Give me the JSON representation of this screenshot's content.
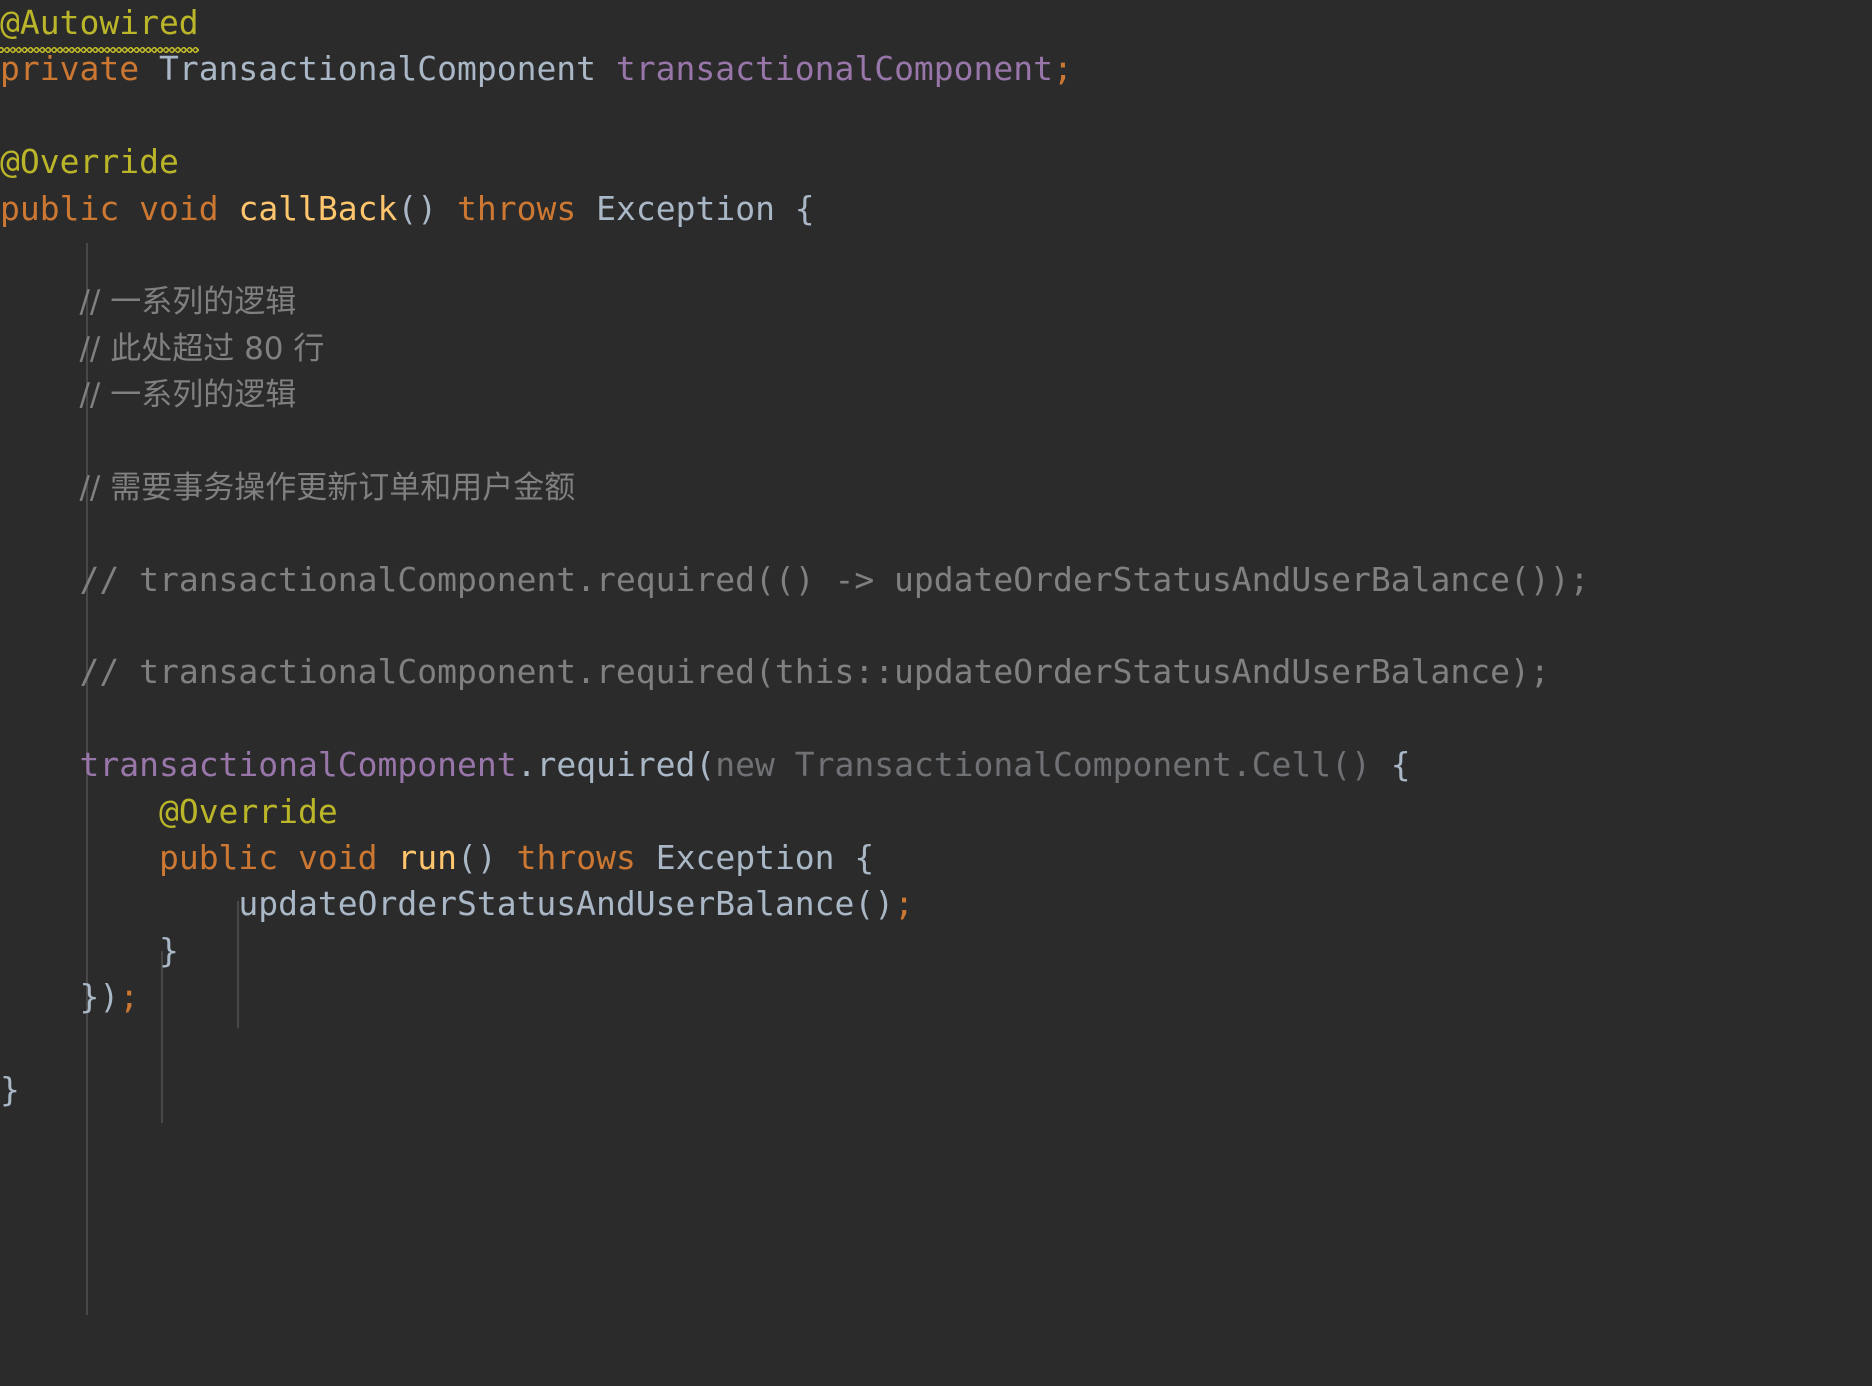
{
  "editor": {
    "background_color": "#2b2b2b",
    "language": "Java",
    "theme": "Darcula",
    "colors": {
      "default_text": "#a9b7c6",
      "annotation": "#bbb529",
      "keyword": "#cc7832",
      "method_name": "#ffc66d",
      "instance_field": "#9876aa",
      "comment": "#808080",
      "dimmed_inferred": "#6f7174",
      "indent_guide": "#4a4a4a",
      "warning_squiggle": "#bbb529"
    },
    "warnings": [
      {
        "target": "@Autowired",
        "style": "wavy-underline",
        "color": "#bbb529"
      }
    ],
    "lines": [
      {
        "n": 1,
        "indent": 0,
        "tokens": [
          {
            "t": "@Autowired",
            "c": "anno",
            "squiggle": true
          }
        ]
      },
      {
        "n": 2,
        "indent": 0,
        "tokens": [
          {
            "t": "private",
            "c": "kw"
          },
          {
            "t": " ",
            "c": "plain"
          },
          {
            "t": "TransactionalComponent",
            "c": "type"
          },
          {
            "t": " ",
            "c": "plain"
          },
          {
            "t": "transactionalComponent",
            "c": "field"
          },
          {
            "t": ";",
            "c": "semi"
          }
        ]
      },
      {
        "n": 3,
        "indent": 0,
        "tokens": []
      },
      {
        "n": 4,
        "indent": 0,
        "tokens": [
          {
            "t": "@Override",
            "c": "anno"
          }
        ]
      },
      {
        "n": 5,
        "indent": 0,
        "tokens": [
          {
            "t": "public",
            "c": "kw"
          },
          {
            "t": " ",
            "c": "plain"
          },
          {
            "t": "void",
            "c": "kw"
          },
          {
            "t": " ",
            "c": "plain"
          },
          {
            "t": "callBack",
            "c": "method"
          },
          {
            "t": "()",
            "c": "punc"
          },
          {
            "t": " ",
            "c": "plain"
          },
          {
            "t": "throws",
            "c": "kw"
          },
          {
            "t": " ",
            "c": "plain"
          },
          {
            "t": "Exception",
            "c": "type"
          },
          {
            "t": " {",
            "c": "punc"
          }
        ]
      },
      {
        "n": 6,
        "indent": 1,
        "tokens": []
      },
      {
        "n": 7,
        "indent": 1,
        "tokens": [
          {
            "t": "// 一系列的逻辑",
            "c": "comment",
            "cjk": true
          }
        ]
      },
      {
        "n": 8,
        "indent": 1,
        "tokens": [
          {
            "t": "// 此处超过 80 行",
            "c": "comment",
            "cjk": true
          }
        ]
      },
      {
        "n": 9,
        "indent": 1,
        "tokens": [
          {
            "t": "// 一系列的逻辑",
            "c": "comment",
            "cjk": true
          }
        ]
      },
      {
        "n": 10,
        "indent": 1,
        "tokens": []
      },
      {
        "n": 11,
        "indent": 1,
        "tokens": [
          {
            "t": "// 需要事务操作更新订单和用户金额",
            "c": "comment",
            "cjk": true
          }
        ]
      },
      {
        "n": 12,
        "indent": 1,
        "tokens": []
      },
      {
        "n": 13,
        "indent": 1,
        "tokens": [
          {
            "t": "// transactionalComponent.required(() -> updateOrderStatusAndUserBalance());",
            "c": "comment"
          }
        ]
      },
      {
        "n": 14,
        "indent": 1,
        "tokens": []
      },
      {
        "n": 15,
        "indent": 1,
        "tokens": [
          {
            "t": "// transactionalComponent.required(this::updateOrderStatusAndUserBalance);",
            "c": "comment"
          }
        ]
      },
      {
        "n": 16,
        "indent": 1,
        "tokens": []
      },
      {
        "n": 17,
        "indent": 1,
        "tokens": [
          {
            "t": "transactionalComponent",
            "c": "field"
          },
          {
            "t": ".required(",
            "c": "plain"
          },
          {
            "t": "new TransactionalComponent.Cell()",
            "c": "dim"
          },
          {
            "t": " {",
            "c": "punc"
          }
        ]
      },
      {
        "n": 18,
        "indent": 2,
        "tokens": [
          {
            "t": "@Override",
            "c": "anno"
          }
        ]
      },
      {
        "n": 19,
        "indent": 2,
        "tokens": [
          {
            "t": "public",
            "c": "kw"
          },
          {
            "t": " ",
            "c": "plain"
          },
          {
            "t": "void",
            "c": "kw"
          },
          {
            "t": " ",
            "c": "plain"
          },
          {
            "t": "run",
            "c": "method"
          },
          {
            "t": "()",
            "c": "punc"
          },
          {
            "t": " ",
            "c": "plain"
          },
          {
            "t": "throws",
            "c": "kw"
          },
          {
            "t": " ",
            "c": "plain"
          },
          {
            "t": "Exception",
            "c": "type"
          },
          {
            "t": " {",
            "c": "punc"
          }
        ]
      },
      {
        "n": 20,
        "indent": 3,
        "tokens": [
          {
            "t": "updateOrderStatusAndUserBalance",
            "c": "plain"
          },
          {
            "t": "()",
            "c": "punc"
          },
          {
            "t": ";",
            "c": "semi"
          }
        ]
      },
      {
        "n": 21,
        "indent": 2,
        "tokens": [
          {
            "t": "}",
            "c": "punc"
          }
        ]
      },
      {
        "n": 22,
        "indent": 1,
        "tokens": [
          {
            "t": "})",
            "c": "punc"
          },
          {
            "t": ";",
            "c": "semi"
          }
        ]
      },
      {
        "n": 23,
        "indent": 0,
        "tokens": []
      },
      {
        "n": 24,
        "indent": 0,
        "tokens": [
          {
            "t": "}",
            "c": "punc"
          }
        ]
      }
    ]
  }
}
